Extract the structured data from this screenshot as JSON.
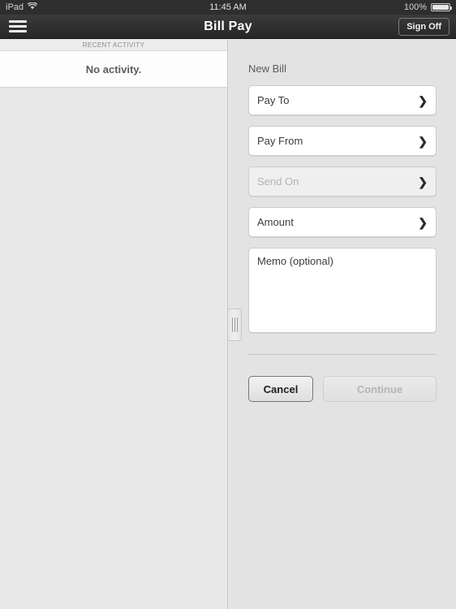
{
  "status_bar": {
    "device_label": "iPad",
    "wifi_icon": "wifi-icon",
    "time": "11:45 AM",
    "battery_percent": "100%",
    "battery_icon": "battery-full-icon"
  },
  "nav_bar": {
    "menu_icon": "hamburger-menu-icon",
    "title": "Bill Pay",
    "sign_off_label": "Sign Off"
  },
  "master_panel": {
    "section_header": "RECENT ACTIVITY",
    "empty_message": "No activity."
  },
  "split_handle": {
    "icon": "drag-handle-icon"
  },
  "detail_panel": {
    "title": "New Bill",
    "fields": [
      {
        "label": "Pay To",
        "muted": false,
        "chevron": "chevron-right-icon"
      },
      {
        "label": "Pay From",
        "muted": false,
        "chevron": "chevron-right-icon"
      },
      {
        "label": "Send On",
        "muted": true,
        "chevron": "chevron-right-icon"
      },
      {
        "label": "Amount",
        "muted": false,
        "chevron": "chevron-right-icon"
      }
    ],
    "memo_placeholder": "Memo (optional)",
    "buttons": {
      "cancel_label": "Cancel",
      "continue_label": "Continue"
    }
  },
  "colors": {
    "navbar_bg": "#303030",
    "master_bg": "#e8e8e8",
    "detail_bg": "#e3e3e3",
    "card_bg": "#ffffff",
    "field_border": "#cccccc",
    "muted_text": "#b3b3b3"
  }
}
